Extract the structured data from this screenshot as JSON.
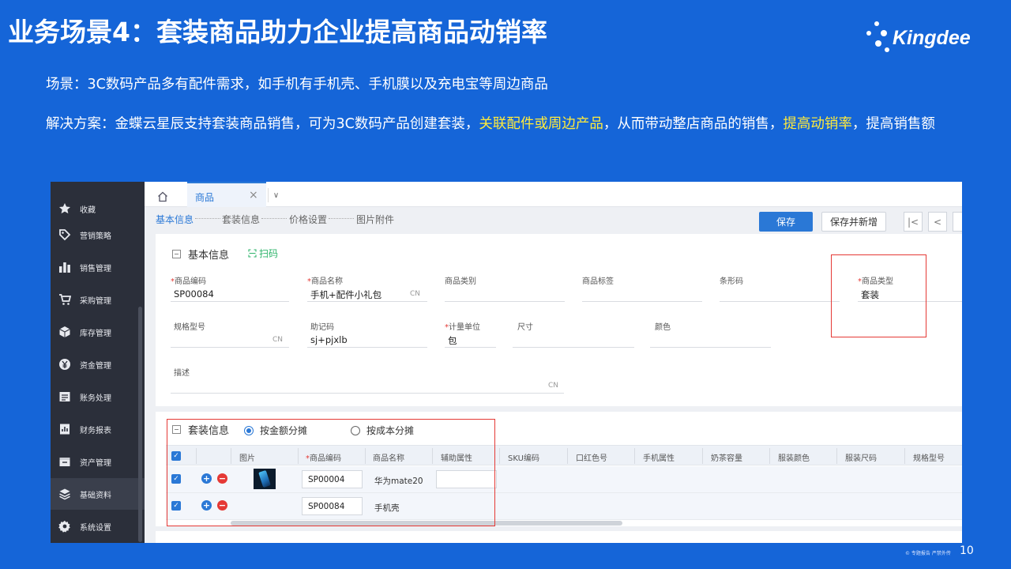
{
  "slide": {
    "title": "业务场景4：套装商品助力企业提高商品动销率",
    "logo_text": "Kingdee",
    "scene_text": "场景：3C数码产品多有配件需求，如手机有手机壳、手机膜以及充电宝等周边商品",
    "solution_prefix": "解决方案：金蝶云星辰支持套装商品销售，可为3C数码产品创建套装，",
    "solution_hl1": "关联配件或周边产品",
    "solution_mid": "，从而带动整店商品的销售，",
    "solution_hl2": "提高动销率",
    "solution_suffix": "，提高销售额",
    "footer_note": "© 专题报告 严禁外传",
    "page_number": "10",
    "highlight_color": "#ffeb3b",
    "background_color": "#1565d8"
  },
  "sidebar": {
    "items": [
      {
        "label": "收藏",
        "icon": "star-icon"
      },
      {
        "label": "营销策略",
        "icon": "tag-icon"
      },
      {
        "label": "销售管理",
        "icon": "bar-chart-icon"
      },
      {
        "label": "采购管理",
        "icon": "cart-icon"
      },
      {
        "label": "库存管理",
        "icon": "box-icon"
      },
      {
        "label": "资金管理",
        "icon": "yen-icon"
      },
      {
        "label": "账务处理",
        "icon": "ledger-icon"
      },
      {
        "label": "财务报表",
        "icon": "report-icon"
      },
      {
        "label": "资产管理",
        "icon": "asset-icon"
      },
      {
        "label": "基础资料",
        "icon": "layers-icon"
      },
      {
        "label": "系统设置",
        "icon": "gear-icon"
      }
    ]
  },
  "tabs": {
    "active_label": "商品",
    "close_glyph": "×",
    "more_glyph": "∨"
  },
  "steps": [
    "基本信息",
    "套装信息",
    "价格设置",
    "图片附件"
  ],
  "toolbar": {
    "save_label": "保存",
    "save_new_label": "保存并新增",
    "first_glyph": "|<",
    "prev_glyph": "<"
  },
  "basic_info": {
    "title": "基本信息",
    "scan_label": "扫码",
    "fields": {
      "code": {
        "label": "商品编码",
        "value": "SP00084",
        "required": "*"
      },
      "name": {
        "label": "商品名称",
        "value": "手机+配件小礼包",
        "suffix": "CN",
        "required": "*"
      },
      "category": {
        "label": "商品类别",
        "value": ""
      },
      "tag": {
        "label": "商品标签",
        "value": ""
      },
      "barcode": {
        "label": "条形码",
        "value": ""
      },
      "type": {
        "label": "商品类型",
        "value": "套装",
        "required": "*"
      },
      "spec": {
        "label": "规格型号",
        "value": "",
        "suffix": "CN"
      },
      "mnemonic": {
        "label": "助记码",
        "value": "sj+pjxlb"
      },
      "unit": {
        "label": "计量单位",
        "value": "包",
        "required": "*"
      },
      "size": {
        "label": "尺寸",
        "value": ""
      },
      "color": {
        "label": "颜色",
        "value": ""
      },
      "desc": {
        "label": "描述",
        "value": "",
        "suffix": "CN"
      }
    }
  },
  "bundle_info": {
    "title": "套装信息",
    "radio_by_amount": "按金额分摊",
    "radio_by_cost": "按成本分摊",
    "selected_radio": "按金额分摊",
    "columns": [
      "图片",
      "商品编码",
      "商品名称",
      "辅助属性",
      "SKU编码",
      "口红色号",
      "手机属性",
      "奶茶容量",
      "服装颜色",
      "服装尺码",
      "规格型号"
    ],
    "required_mark": "*",
    "rows": [
      {
        "code": "SP00004",
        "name": "华为mate20",
        "has_image": true,
        "checked": true
      },
      {
        "code": "SP00084",
        "name": "手机壳",
        "has_image": false,
        "checked": true
      }
    ]
  }
}
